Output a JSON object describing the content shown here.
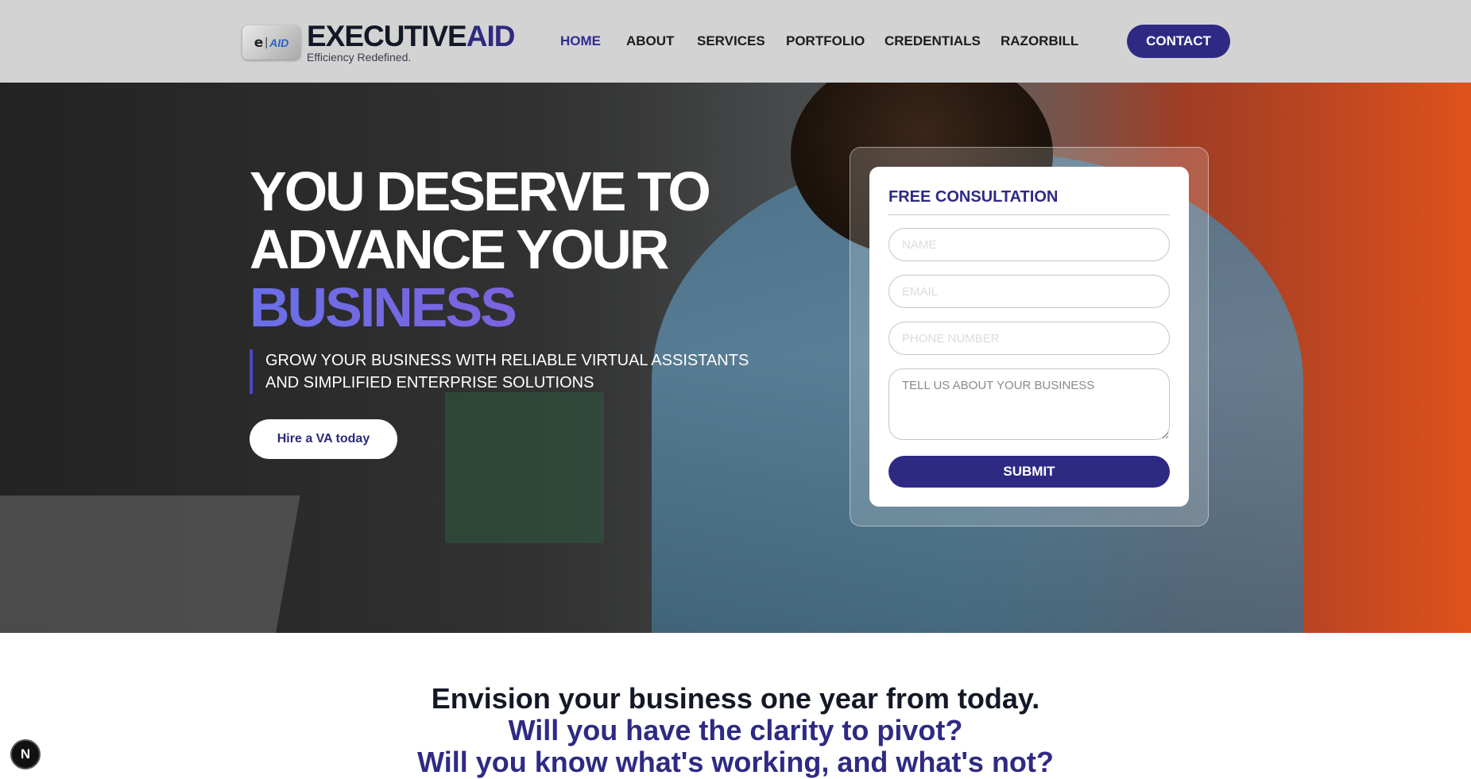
{
  "header": {
    "logo": {
      "badge_e": "e",
      "badge_sep": "|",
      "badge_aid": "AID",
      "word_dark": "EXECUTIVE",
      "word_accent": "AID",
      "tagline": "Efficiency Redefined."
    },
    "nav": [
      {
        "label": "HOME",
        "active": true
      },
      {
        "label": "ABOUT",
        "active": false
      },
      {
        "label": "SERVICES",
        "active": false
      },
      {
        "label": "PORTFOLIO",
        "active": false
      },
      {
        "label": "CREDENTIALS",
        "active": false
      },
      {
        "label": "RAZORBILL",
        "active": false
      }
    ],
    "contact_label": "CONTACT"
  },
  "hero": {
    "headline_line1": "YOU DESERVE TO",
    "headline_line2": "ADVANCE YOUR",
    "headline_accent": "BUSINESS",
    "subtext_line1": "GROW YOUR BUSINESS WITH RELIABLE VIRTUAL ASSISTANTS",
    "subtext_line2": "AND SIMPLIFIED ENTERPRISE SOLUTIONS",
    "cta_label": "Hire a VA today"
  },
  "form": {
    "title": "FREE CONSULTATION",
    "name_placeholder": "NAME",
    "email_placeholder": "EMAIL",
    "phone_placeholder": "PHONE NUMBER",
    "message_placeholder": "TELL US ABOUT YOUR BUSINESS",
    "submit_label": "SUBMIT"
  },
  "envision": {
    "line1": "Envision your business one year from today.",
    "line2": "Will you have the clarity to pivot?",
    "line3": "Will you know what's working, and what's not?"
  },
  "dev_badge": "N",
  "colors": {
    "brand": "#2e2a84",
    "header_bg": "#d3d3d3",
    "accent_gradient_start": "#6a6fe6",
    "accent_gradient_end": "#8b5ad8"
  }
}
